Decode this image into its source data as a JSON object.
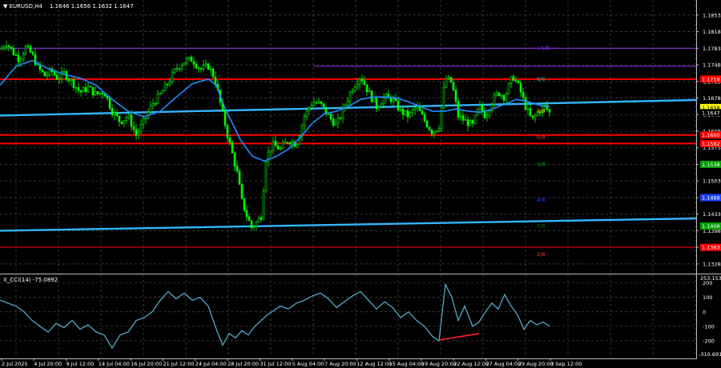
{
  "header": {
    "symbol_label": "▼ EURUSD,H4",
    "ohlc": "1.1646 1.1656 1.1632 1.1647"
  },
  "indicator": {
    "label": "X_CCI(14) -75.0892",
    "ticks": [
      "200",
      "100",
      "0",
      "-100",
      "-200"
    ],
    "top_value": "253.1533",
    "bottom_value": "-310.691"
  },
  "colors": {
    "background": "#000000",
    "bull_candle": "#00ff00",
    "ma_line": "#1e90ff",
    "trend_line": "#33b6ff",
    "support_resistance": "#ff0000",
    "murray_purple": "#9b30ff",
    "cci_line": "#5ab4d6",
    "divergence": "#ff2222"
  },
  "chart_data": [
    {
      "type": "candlestick",
      "symbol": "EURUSD",
      "timeframe": "H4",
      "ylim": [
        1.1311,
        1.1878
      ],
      "price_ticks": [
        "1.1853",
        "1.1818",
        "1.1783",
        "1.1748",
        "1.1713",
        "1.1678",
        "1.1643",
        "1.1608",
        "1.1573",
        "1.1538",
        "1.1503",
        "1.1468",
        "1.1433",
        "1.1398",
        "1.1363",
        "1.1328"
      ],
      "x_ticks": [
        "2 Jul 2025",
        "4 Jul 20:00",
        "9 Jul 12:00",
        "14 Jul 04:00",
        "16 Jul 20:00",
        "21 Jul 12:00",
        "24 Jul 04:00",
        "28 Jul 20:00",
        "31 Jul 12:00",
        "5 Aug 04:00",
        "7 Aug 20:00",
        "12 Aug 12:00",
        "15 Aug 04:00",
        "19 Aug 20:00",
        "22 Aug 12:00",
        "27 Aug 04:00",
        "29 Aug 20:00",
        "3 Sep 12:00"
      ],
      "close_path": [
        [
          0,
          1.178
        ],
        [
          8,
          1.1795
        ],
        [
          16,
          1.1775
        ],
        [
          24,
          1.176
        ],
        [
          32,
          1.1785
        ],
        [
          40,
          1.177
        ],
        [
          48,
          1.174
        ],
        [
          56,
          1.1725
        ],
        [
          64,
          1.1735
        ],
        [
          72,
          1.172
        ],
        [
          80,
          1.173
        ],
        [
          90,
          1.1712
        ],
        [
          100,
          1.169
        ],
        [
          110,
          1.17
        ],
        [
          120,
          1.1685
        ],
        [
          130,
          1.1692
        ],
        [
          140,
          1.165
        ],
        [
          150,
          1.1628
        ],
        [
          160,
          1.164
        ],
        [
          170,
          1.16
        ],
        [
          180,
          1.163
        ],
        [
          190,
          1.1665
        ],
        [
          200,
          1.1685
        ],
        [
          210,
          1.171
        ],
        [
          220,
          1.174
        ],
        [
          230,
          1.1755
        ],
        [
          240,
          1.176
        ],
        [
          250,
          1.1738
        ],
        [
          260,
          1.1745
        ],
        [
          268,
          1.172
        ],
        [
          276,
          1.166
        ],
        [
          284,
          1.16
        ],
        [
          290,
          1.156
        ],
        [
          296,
          1.152
        ],
        [
          302,
          1.146
        ],
        [
          308,
          1.143
        ],
        [
          314,
          1.1405
        ],
        [
          320,
          1.1415
        ],
        [
          326,
          1.143
        ],
        [
          332,
          1.155
        ],
        [
          340,
          1.158
        ],
        [
          350,
          1.157
        ],
        [
          360,
          1.159
        ],
        [
          370,
          1.158
        ],
        [
          380,
          1.164
        ],
        [
          390,
          1.167
        ],
        [
          400,
          1.1665
        ],
        [
          410,
          1.164
        ],
        [
          420,
          1.162
        ],
        [
          430,
          1.166
        ],
        [
          440,
          1.17
        ],
        [
          450,
          1.1725
        ],
        [
          460,
          1.169
        ],
        [
          470,
          1.166
        ],
        [
          480,
          1.168
        ],
        [
          490,
          1.1675
        ],
        [
          500,
          1.165
        ],
        [
          510,
          1.164
        ],
        [
          520,
          1.166
        ],
        [
          530,
          1.163
        ],
        [
          540,
          1.1605
        ],
        [
          548,
          1.162
        ],
        [
          556,
          1.172
        ],
        [
          564,
          1.171
        ],
        [
          572,
          1.164
        ],
        [
          580,
          1.163
        ],
        [
          590,
          1.162
        ],
        [
          598,
          1.166
        ],
        [
          606,
          1.164
        ],
        [
          614,
          1.167
        ],
        [
          622,
          1.169
        ],
        [
          630,
          1.168
        ],
        [
          640,
          1.1725
        ],
        [
          648,
          1.17
        ],
        [
          656,
          1.166
        ],
        [
          664,
          1.163
        ],
        [
          672,
          1.165
        ],
        [
          680,
          1.166
        ],
        [
          686,
          1.1647
        ]
      ],
      "ma_path": [
        [
          0,
          1.1705
        ],
        [
          20,
          1.1745
        ],
        [
          40,
          1.1757
        ],
        [
          60,
          1.174
        ],
        [
          80,
          1.1728
        ],
        [
          100,
          1.172
        ],
        [
          120,
          1.1705
        ],
        [
          140,
          1.1675
        ],
        [
          160,
          1.165
        ],
        [
          180,
          1.1638
        ],
        [
          200,
          1.165
        ],
        [
          220,
          1.168
        ],
        [
          240,
          1.1708
        ],
        [
          260,
          1.1718
        ],
        [
          270,
          1.1705
        ],
        [
          280,
          1.166
        ],
        [
          290,
          1.1625
        ],
        [
          300,
          1.159
        ],
        [
          315,
          1.1555
        ],
        [
          330,
          1.1545
        ],
        [
          345,
          1.1555
        ],
        [
          360,
          1.157
        ],
        [
          375,
          1.1595
        ],
        [
          390,
          1.1625
        ],
        [
          405,
          1.1645
        ],
        [
          420,
          1.165
        ],
        [
          435,
          1.166
        ],
        [
          450,
          1.1675
        ],
        [
          465,
          1.168
        ],
        [
          480,
          1.168
        ],
        [
          495,
          1.1678
        ],
        [
          510,
          1.167
        ],
        [
          525,
          1.166
        ],
        [
          540,
          1.165
        ],
        [
          555,
          1.165
        ],
        [
          570,
          1.1655
        ],
        [
          585,
          1.165
        ],
        [
          600,
          1.1648
        ],
        [
          615,
          1.1655
        ],
        [
          630,
          1.1665
        ],
        [
          645,
          1.1675
        ],
        [
          660,
          1.167
        ],
        [
          675,
          1.1662
        ],
        [
          686,
          1.166
        ]
      ],
      "trend_lines": [
        {
          "from": [
            0,
            1.1641
          ],
          "to": [
            900,
            1.1675
          ]
        },
        {
          "from": [
            0,
            1.1398
          ],
          "to": [
            900,
            1.1425
          ]
        }
      ],
      "horizontal_levels": [
        {
          "value": 1.1718,
          "color": "#ff0000",
          "width": 2
        },
        {
          "value": 1.16,
          "color": "#ff0000",
          "width": 2
        },
        {
          "value": 1.1582,
          "color": "#ff0000",
          "width": 2
        },
        {
          "value": 1.1363,
          "color": "#ff0000",
          "width": 1
        },
        {
          "value": 1.1783,
          "color": "#9b30ff",
          "width": 1
        },
        {
          "value": 1.1745,
          "color": "#9b30ff",
          "width": 1,
          "from_x": 392
        }
      ],
      "murray_labels": [
        {
          "text": "+1/8",
          "value": 1.1783,
          "color": "#9b30ff"
        },
        {
          "text": "8/8",
          "value": 1.1718,
          "color": "#20b2aa"
        },
        {
          "text": "7/8",
          "value": 1.165,
          "color": "#ffd700"
        },
        {
          "text": "6/8",
          "value": 1.1595,
          "color": "#ff3333"
        },
        {
          "text": "5/8",
          "value": 1.1538,
          "color": "#00a000"
        },
        {
          "text": "4/8",
          "value": 1.1463,
          "color": "#1e40ff"
        },
        {
          "text": "3/8",
          "value": 1.1408,
          "color": "#008000"
        },
        {
          "text": "2/8",
          "value": 1.1348,
          "color": "#ff3333"
        }
      ],
      "price_tags": [
        {
          "text": "1.1718",
          "value": 1.1718,
          "bg": "#ff0000",
          "fg": "#ffffff"
        },
        {
          "text": "1.1658",
          "value": 1.1658,
          "bg": "#ffff00",
          "fg": "#000000"
        },
        {
          "text": "1.1647",
          "value": 1.1647,
          "bg": "#000000",
          "fg": "#ffffff"
        },
        {
          "text": "1.1600",
          "value": 1.16,
          "bg": "#ff0000",
          "fg": "#ffffff"
        },
        {
          "text": "1.1582",
          "value": 1.1582,
          "bg": "#ff0000",
          "fg": "#ffffff"
        },
        {
          "text": "1.1538",
          "value": 1.1538,
          "bg": "#00a000",
          "fg": "#ffffff"
        },
        {
          "text": "1.1468",
          "value": 1.1468,
          "bg": "#1e40ff",
          "fg": "#ffffff"
        },
        {
          "text": "1.1408",
          "value": 1.1408,
          "bg": "#00a000",
          "fg": "#ffffff"
        },
        {
          "text": "1.1363",
          "value": 1.1363,
          "bg": "#ff0000",
          "fg": "#ffffff"
        }
      ]
    },
    {
      "type": "line",
      "name": "X_CCI(14)",
      "ylim": [
        -310.691,
        253.1533
      ],
      "levels": [
        200,
        100,
        -100,
        -200
      ],
      "path": [
        [
          0,
          80
        ],
        [
          10,
          60
        ],
        [
          20,
          40
        ],
        [
          30,
          0
        ],
        [
          40,
          -60
        ],
        [
          50,
          -100
        ],
        [
          60,
          -140
        ],
        [
          70,
          -80
        ],
        [
          80,
          -110
        ],
        [
          90,
          -60
        ],
        [
          100,
          -120
        ],
        [
          110,
          -90
        ],
        [
          120,
          -140
        ],
        [
          130,
          -160
        ],
        [
          140,
          -250
        ],
        [
          150,
          -160
        ],
        [
          160,
          -140
        ],
        [
          170,
          -60
        ],
        [
          180,
          -40
        ],
        [
          190,
          0
        ],
        [
          200,
          80
        ],
        [
          210,
          140
        ],
        [
          220,
          90
        ],
        [
          230,
          130
        ],
        [
          240,
          80
        ],
        [
          250,
          100
        ],
        [
          260,
          40
        ],
        [
          270,
          -120
        ],
        [
          278,
          -230
        ],
        [
          286,
          -150
        ],
        [
          294,
          -180
        ],
        [
          302,
          -130
        ],
        [
          310,
          -160
        ],
        [
          318,
          -100
        ],
        [
          326,
          -60
        ],
        [
          334,
          -20
        ],
        [
          342,
          10
        ],
        [
          350,
          40
        ],
        [
          360,
          20
        ],
        [
          370,
          60
        ],
        [
          380,
          80
        ],
        [
          390,
          110
        ],
        [
          400,
          130
        ],
        [
          410,
          90
        ],
        [
          420,
          30
        ],
        [
          430,
          70
        ],
        [
          440,
          110
        ],
        [
          450,
          140
        ],
        [
          460,
          80
        ],
        [
          470,
          20
        ],
        [
          480,
          70
        ],
        [
          490,
          30
        ],
        [
          500,
          -40
        ],
        [
          510,
          0
        ],
        [
          520,
          -60
        ],
        [
          530,
          -100
        ],
        [
          540,
          -170
        ],
        [
          548,
          -200
        ],
        [
          556,
          190
        ],
        [
          564,
          100
        ],
        [
          572,
          -60
        ],
        [
          580,
          40
        ],
        [
          590,
          -100
        ],
        [
          598,
          -70
        ],
        [
          606,
          0
        ],
        [
          614,
          60
        ],
        [
          622,
          20
        ],
        [
          630,
          120
        ],
        [
          638,
          40
        ],
        [
          646,
          -20
        ],
        [
          654,
          -120
        ],
        [
          662,
          -60
        ],
        [
          670,
          -90
        ],
        [
          678,
          -70
        ],
        [
          686,
          -100
        ]
      ],
      "divergence_line": {
        "from": [
          548,
          -195
        ],
        "to": [
          598,
          -150
        ]
      }
    }
  ]
}
